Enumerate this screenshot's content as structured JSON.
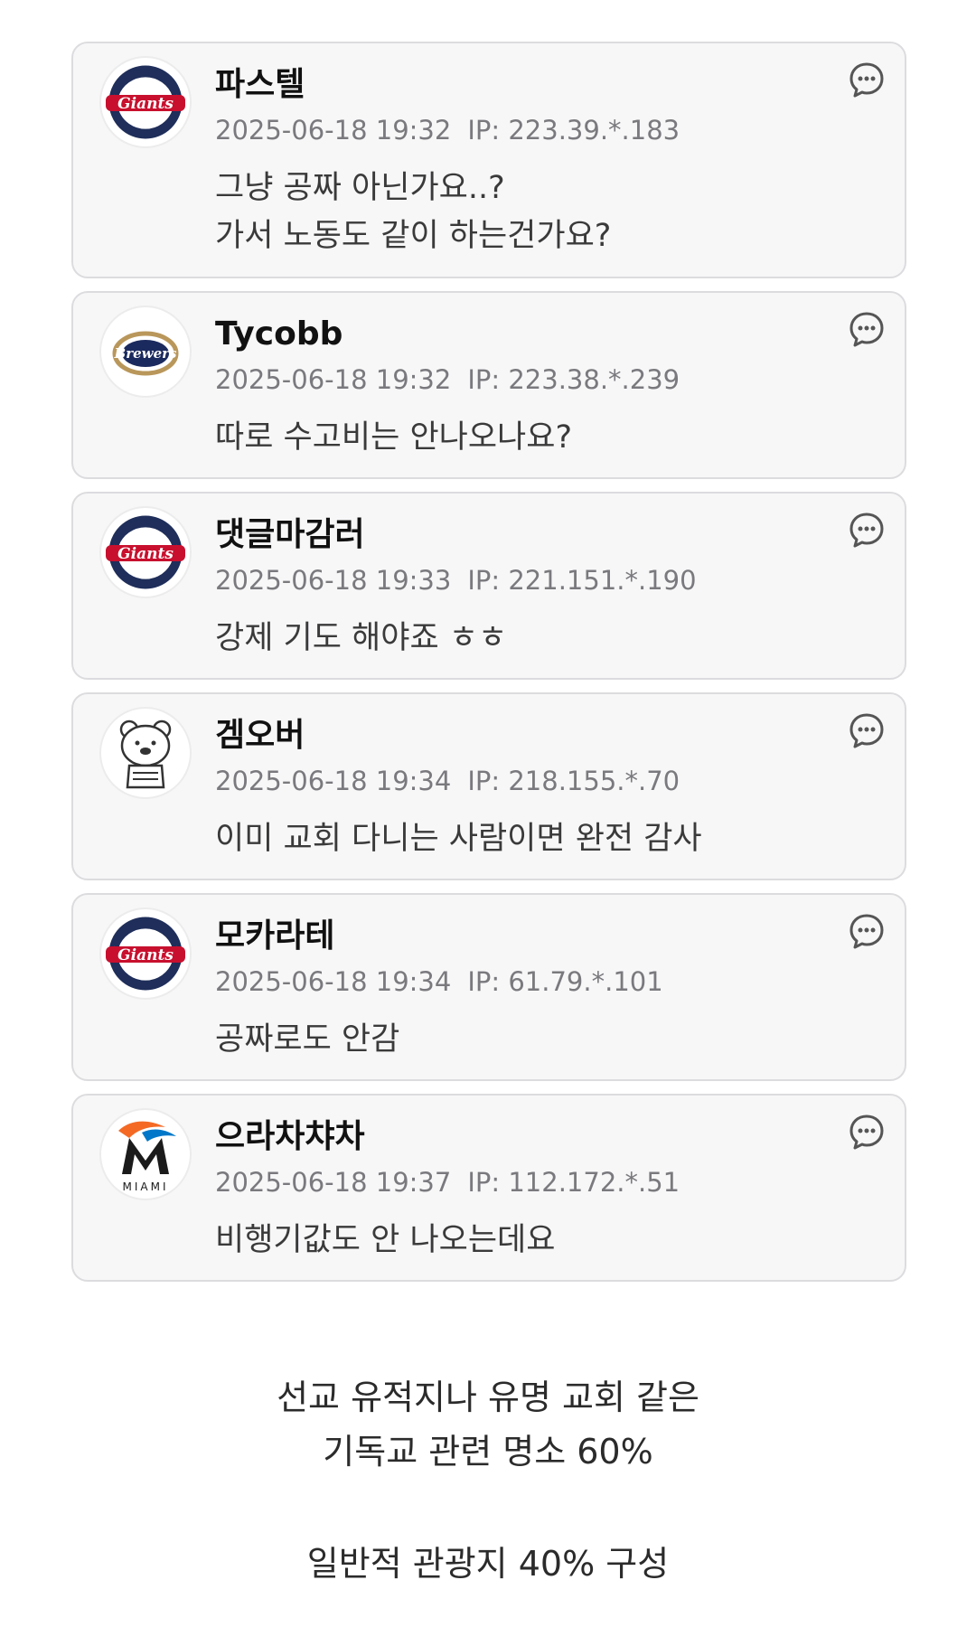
{
  "comments": [
    {
      "nickname": "파스텔",
      "date": "2025-06-18 19:32",
      "ip": "IP: 223.39.*.183",
      "lines": [
        "그냥 공짜 아닌가요..?",
        "가서 노동도 같이 하는건가요?"
      ],
      "avatar": "giants-logo",
      "avatar_text": "Giants"
    },
    {
      "nickname": "Tycobb",
      "date": "2025-06-18 19:32",
      "ip": "IP: 223.38.*.239",
      "lines": [
        "따로 수고비는 안나오나요?"
      ],
      "avatar": "brewers-logo",
      "avatar_text": "Brewers"
    },
    {
      "nickname": "댓글마감러",
      "date": "2025-06-18 19:33",
      "ip": "IP: 221.151.*.190",
      "lines": [
        "강제 기도 해야죠 ㅎㅎ"
      ],
      "avatar": "giants-logo",
      "avatar_text": "Giants"
    },
    {
      "nickname": "겜오버",
      "date": "2025-06-18 19:34",
      "ip": "IP: 218.155.*.70",
      "lines": [
        "이미 교회 다니는 사람이면 완전 감사"
      ],
      "avatar": "bear-icon"
    },
    {
      "nickname": "모카라테",
      "date": "2025-06-18 19:34",
      "ip": "IP: 61.79.*.101",
      "lines": [
        "공짜로도 안감"
      ],
      "avatar": "giants-logo",
      "avatar_text": "Giants"
    },
    {
      "nickname": "으라차챠차",
      "date": "2025-06-18 19:37",
      "ip": "IP: 112.172.*.51",
      "lines": [
        "비행기값도 안 나오는데요"
      ],
      "avatar": "marlins-logo",
      "avatar_text": "MIAMI"
    }
  ],
  "reply_icon": "comment-bubble-icon",
  "caption": {
    "line1": "선교 유적지나 유명 교회 같은",
    "line2": "기독교 관련 명소 60%",
    "line3": "일반적 관광지 40% 구성"
  },
  "colors": {
    "card_bg": "#f7f7f8",
    "card_border": "#dcdcdf",
    "meta_text": "#7a7a7e",
    "giants_red": "#c8102e",
    "giants_navy": "#1f2e5a"
  }
}
